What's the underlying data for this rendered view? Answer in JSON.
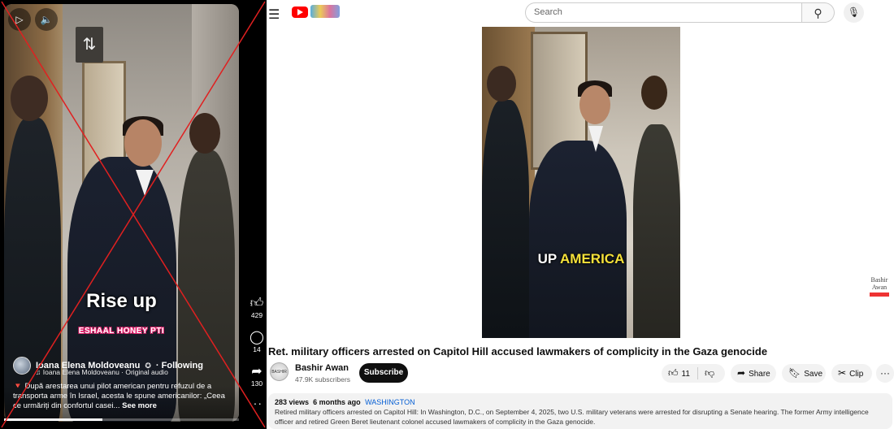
{
  "left_player": {
    "overlay_caption": "Rise up",
    "overlay_sub": "ESHAAL HONEY PTI",
    "channel_name": "Ioana Elena Moldoveanu",
    "following_label": "· Following",
    "audio": "Ioana Elena Moldoveanu · Original audio",
    "description_lead": "După arestarea unui pilot american pentru refuzul de a transporta arme în Israel, acesta le spune americanilor: „Ceea ce urmăriți din confortul casei...",
    "see_more": "See more",
    "likes": "429",
    "comments": "14",
    "shares": "130",
    "progress_percent": 42,
    "icons": {
      "play": "play-icon",
      "volume": "volume-icon",
      "like": "thumbs-up-icon",
      "comment": "comment-icon",
      "share": "share-arrow-icon",
      "more": "more-dots-icon"
    }
  },
  "header": {
    "search_placeholder": "Search"
  },
  "video": {
    "caption_white": "UP ",
    "caption_yellow": "AMERICA",
    "watermark_name": "Bashir Awan"
  },
  "watch": {
    "title": "Ret. military officers arrested on Capitol Hill accused lawmakers of complicity in the Gaza genocide",
    "channel_name": "Bashir Awan",
    "subscribers": "47.9K subscribers",
    "subscribe_label": "Subscribe",
    "like_count": "11",
    "share_label": "Share",
    "save_label": "Save",
    "clip_label": "Clip",
    "views": "283 views",
    "age": "6 months ago",
    "location_tag": "WASHINGTON",
    "description": "Retired military officers arrested on Capitol Hill: In Washington, D.C., on September 4, 2025, two U.S. military veterans were arrested for disrupting a Senate hearing. The former Army intelligence officer and retired Green Beret lieutenant colonel accused lawmakers of complicity in the Gaza genocide."
  },
  "colors": {
    "cross_red": "#e02020",
    "yt_red": "#ff0000",
    "caption_yellow": "#f5e13a"
  }
}
